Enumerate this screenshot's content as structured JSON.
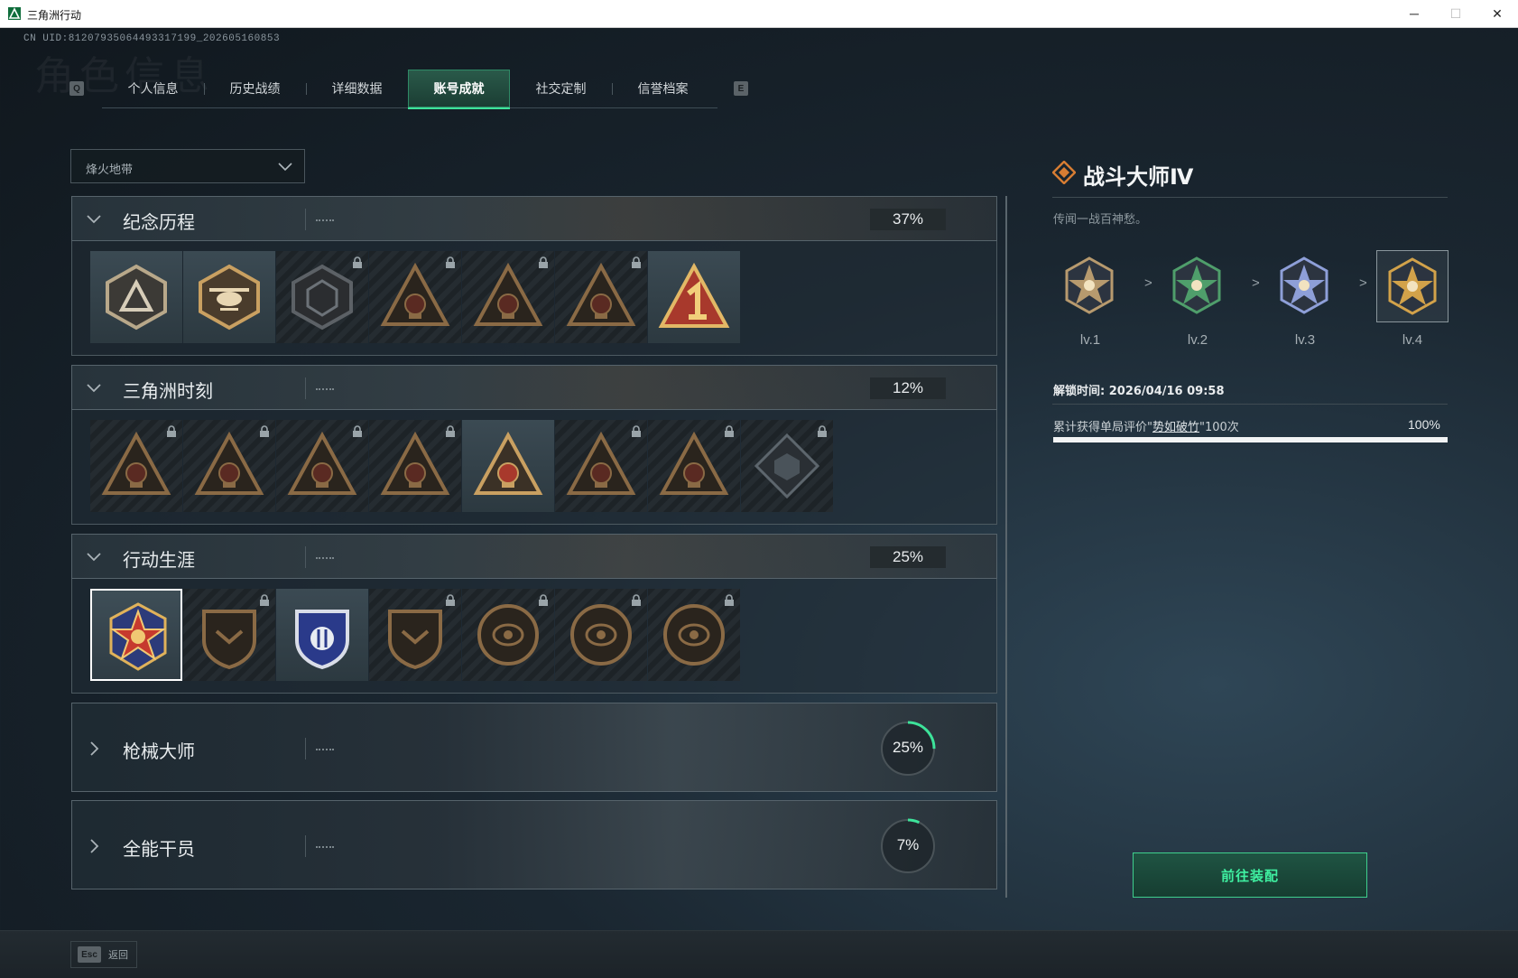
{
  "window": {
    "title": "三角洲行动",
    "min_icon": "minimize-icon",
    "max_icon": "maximize-icon",
    "close_icon": "close-icon"
  },
  "uid": "CN UID:812079350644933171​99_202605160853",
  "page_bg_title": "角色信息",
  "tabs": {
    "left_key": "Q",
    "right_key": "E",
    "items": [
      {
        "label": "个人信息"
      },
      {
        "label": "历史战绩"
      },
      {
        "label": "详细数据"
      },
      {
        "label": "账号成就",
        "active": true
      },
      {
        "label": "社交定制"
      },
      {
        "label": "信誉档案"
      }
    ]
  },
  "mode_select": {
    "value": "烽火地带"
  },
  "sections": [
    {
      "name": "纪念历程",
      "progress": "37%",
      "expanded": true,
      "badges": [
        {
          "icon": "triangle-emblem-icon",
          "locked": false
        },
        {
          "icon": "helicopter-badge-icon",
          "locked": false
        },
        {
          "icon": "shield-hex-badge-icon",
          "locked": true
        },
        {
          "icon": "soldier-crest-icon",
          "locked": true
        },
        {
          "icon": "hooded-operator-icon",
          "locked": true
        },
        {
          "icon": "crossed-weapons-icon",
          "locked": true
        },
        {
          "icon": "number-one-triangle-icon",
          "locked": false
        }
      ]
    },
    {
      "name": "三角洲时刻",
      "progress": "12%",
      "expanded": true,
      "badges": [
        {
          "icon": "crate-triangle-icon",
          "locked": true
        },
        {
          "icon": "vest-triangle-icon",
          "locked": true
        },
        {
          "icon": "kneeling-soldier-icon",
          "locked": true
        },
        {
          "icon": "d20-triangle-icon",
          "locked": true
        },
        {
          "icon": "squad-triangle-icon",
          "locked": false
        },
        {
          "icon": "beast-triangle-icon",
          "locked": true
        },
        {
          "icon": "fish-triangle-icon",
          "locked": true
        },
        {
          "icon": "cube-diamond-icon",
          "locked": true
        }
      ]
    },
    {
      "name": "行动生涯",
      "progress": "25%",
      "expanded": true,
      "badges": [
        {
          "icon": "star-medal-icon",
          "locked": false,
          "selected": true
        },
        {
          "icon": "chevron-shield-icon",
          "locked": true
        },
        {
          "icon": "police-shield-icon",
          "locked": false
        },
        {
          "icon": "hex-shield-icon",
          "locked": true
        },
        {
          "icon": "round-shell-icon",
          "locked": true
        },
        {
          "icon": "skull-compass-icon",
          "locked": true
        },
        {
          "icon": "eye-emblem-icon",
          "locked": true
        }
      ]
    },
    {
      "name": "枪械大师",
      "progress": "25%",
      "progress_value": 0.25,
      "expanded": false
    },
    {
      "name": "全能干员",
      "progress": "7%",
      "progress_value": 0.07,
      "expanded": false
    }
  ],
  "detail": {
    "title": "战斗大师Ⅳ",
    "description": "传闻一战百神愁。",
    "levels": [
      {
        "label": "lv.1",
        "color": "#b79a6e"
      },
      {
        "label": "lv.2",
        "color": "#4f9e6b"
      },
      {
        "label": "lv.3",
        "color": "#8e9fd8"
      },
      {
        "label": "lv.4",
        "color": "#d2a24a"
      }
    ],
    "level_sep": ">",
    "unlock_time": "解锁时间: 2026/04/16 09:58",
    "req_prefix": "累计获得单局评价\"",
    "req_highlight": "势如破竹",
    "req_suffix": "\"100次",
    "req_percent": "100%",
    "req_progress": 1.0,
    "equip_button": "前往装配"
  },
  "bottom": {
    "esc_key": "Esc",
    "back_label": "返回"
  },
  "colors": {
    "accent": "#3de39a",
    "gold": "#c9a061",
    "lock": "#9aa4a9"
  }
}
